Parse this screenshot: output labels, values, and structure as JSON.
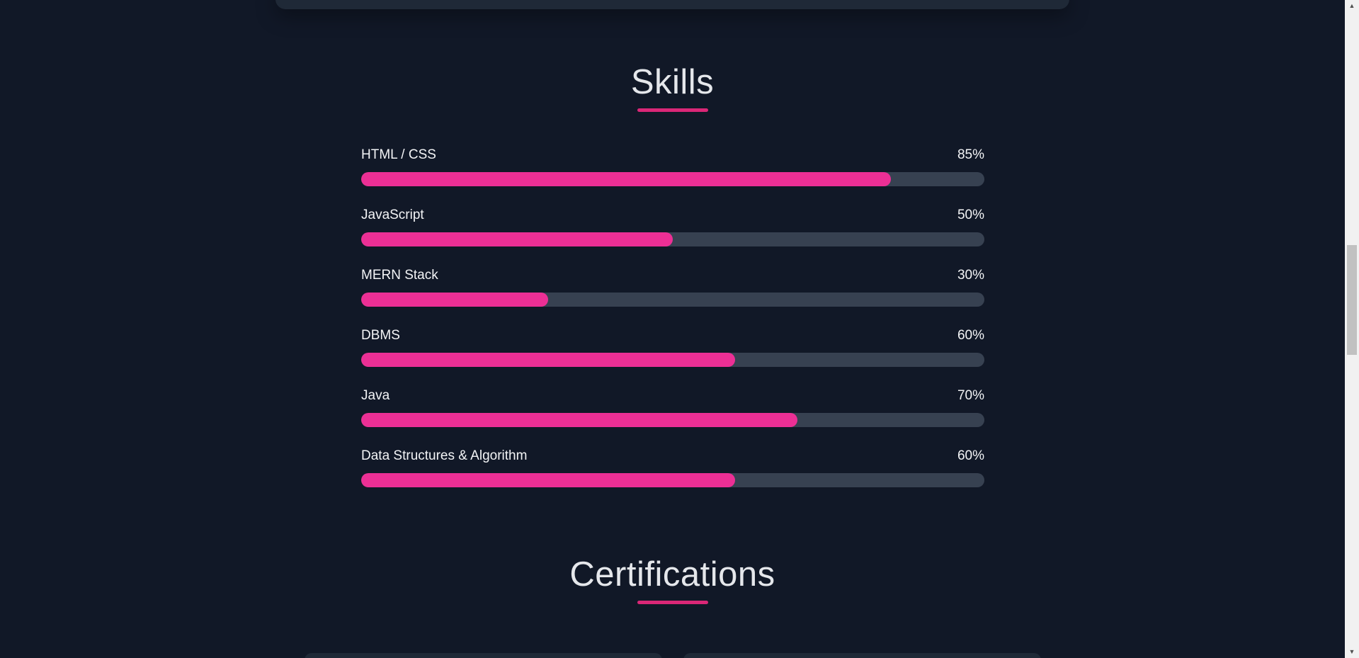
{
  "skills_section": {
    "title": "Skills",
    "items": [
      {
        "name": "HTML / CSS",
        "percent_label": "85%",
        "level": 85
      },
      {
        "name": "JavaScript",
        "percent_label": "50%",
        "level": 50
      },
      {
        "name": "MERN Stack",
        "percent_label": "30%",
        "level": 30
      },
      {
        "name": "DBMS",
        "percent_label": "60%",
        "level": 60
      },
      {
        "name": "Java",
        "percent_label": "70%",
        "level": 70
      },
      {
        "name": "Data Structures & Algorithm",
        "percent_label": "60%",
        "level": 60
      }
    ]
  },
  "certifications_section": {
    "title": "Certifications"
  },
  "colors": {
    "background": "#111827",
    "accent": "#ec2f95",
    "track": "#374151",
    "card": "#1f2937"
  },
  "scrollbar": {
    "up_icon": "triangle-up-icon",
    "down_icon": "triangle-down-icon"
  }
}
